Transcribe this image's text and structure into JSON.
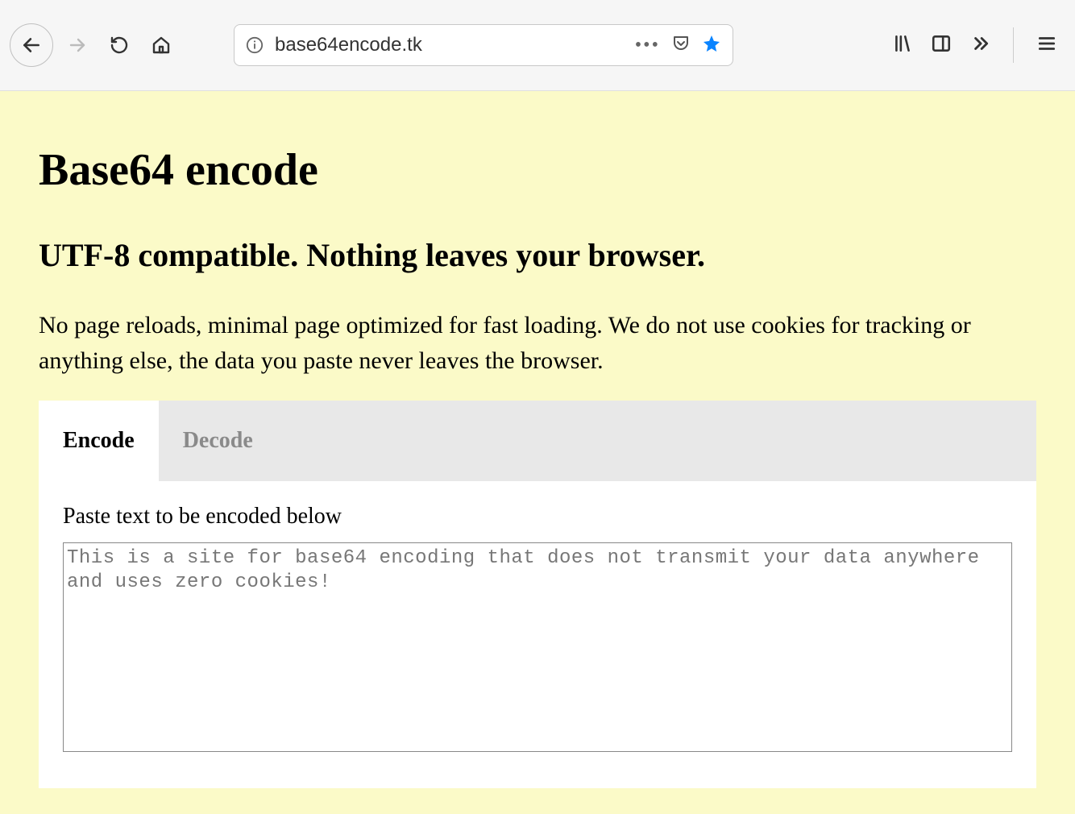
{
  "browser": {
    "url": "base64encode.tk"
  },
  "page": {
    "title": "Base64 encode",
    "subtitle": "UTF-8 compatible. Nothing leaves your browser.",
    "description": "No page reloads, minimal page optimized for fast loading. We do not use cookies for tracking or anything else, the data you paste never leaves the browser.",
    "tabs": {
      "encode": "Encode",
      "decode": "Decode"
    },
    "input_label": "Paste text to be encoded below",
    "input_value": "This is a site for base64 encoding that does not transmit your data anywhere and uses zero cookies!"
  }
}
